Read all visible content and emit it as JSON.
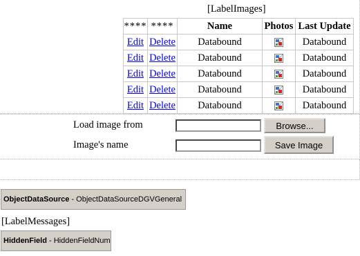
{
  "label_images": "[LabelImages]",
  "grid": {
    "headers": [
      "****",
      "****",
      "Name",
      "Photos",
      "Last Update"
    ],
    "rows": [
      {
        "edit": "Edit",
        "delete": "Delete",
        "name": "Databound",
        "last_update": "Databound"
      },
      {
        "edit": "Edit",
        "delete": "Delete",
        "name": "Databound",
        "last_update": "Databound"
      },
      {
        "edit": "Edit",
        "delete": "Delete",
        "name": "Databound",
        "last_update": "Databound"
      },
      {
        "edit": "Edit",
        "delete": "Delete",
        "name": "Databound",
        "last_update": "Databound"
      },
      {
        "edit": "Edit",
        "delete": "Delete",
        "name": "Databound",
        "last_update": "Databound"
      }
    ],
    "photo_icon": "broken-image-icon"
  },
  "upload": {
    "load_label": "Load image from",
    "browse_label": "Browse...",
    "name_label": "Image's name",
    "save_label": "Save Image",
    "file_value": "",
    "name_value": ""
  },
  "object_data_source": {
    "type": "ObjectDataSource",
    "id": "ObjectDataSourceDGVGeneral"
  },
  "label_messages": "[LabelMessages]",
  "hidden_field": {
    "type": "HiddenField",
    "id": "HiddenFieldNum"
  }
}
